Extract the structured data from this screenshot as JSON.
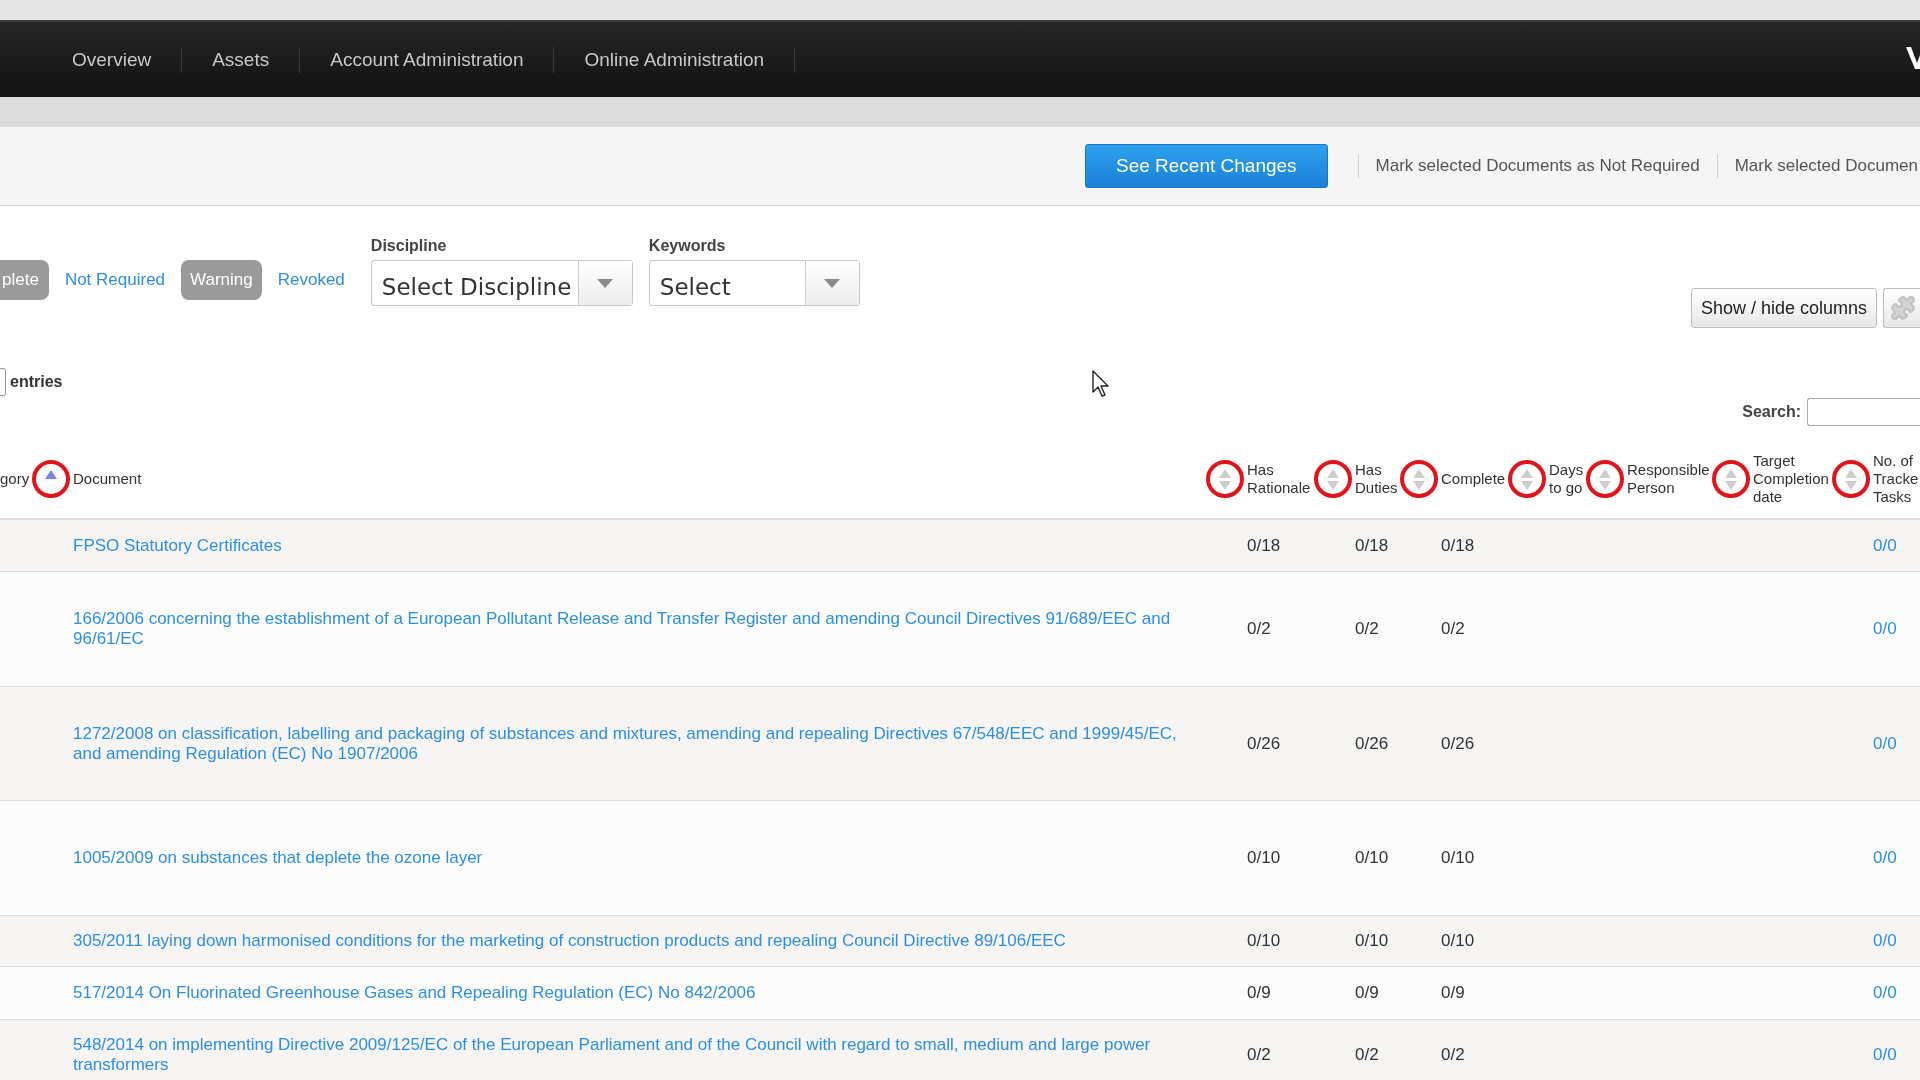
{
  "nav": {
    "items": [
      "Overview",
      "Assets",
      "Account Administration",
      "Online Administration"
    ]
  },
  "toolbar": {
    "button": "See Recent Changes",
    "links": [
      "Mark selected Documents as Not Required",
      "Mark selected Documen"
    ]
  },
  "filters": {
    "status": [
      {
        "label": "plete",
        "selected": true
      },
      {
        "label": "Not Required",
        "selected": false
      },
      {
        "label": "Warning",
        "selected": true
      },
      {
        "label": "Revoked",
        "selected": false
      }
    ],
    "dropdowns": [
      {
        "label": "Discipline",
        "placeholder": "Select Discipline"
      },
      {
        "label": "Keywords",
        "placeholder": "Select"
      }
    ]
  },
  "columns_button": "Show / hide columns",
  "length_menu": {
    "label": "entries"
  },
  "search": {
    "label": "Search:"
  },
  "table": {
    "columns": [
      {
        "label": "gory",
        "sorted": true,
        "circled": true
      },
      {
        "label": "Document",
        "sorted": false,
        "circled": true
      },
      {
        "label": "Has Rationale",
        "sorted": false,
        "circled": true
      },
      {
        "label": "Has Duties",
        "sorted": false,
        "circled": true
      },
      {
        "label": "Complete",
        "sorted": false,
        "circled": true
      },
      {
        "label": "Days to go",
        "sorted": false,
        "circled": true
      },
      {
        "label": "Responsible Person",
        "sorted": false,
        "circled": true
      },
      {
        "label": "Target Completion date",
        "sorted": false,
        "circled": true
      },
      {
        "label": "No. of Tracke Tasks"
      }
    ],
    "rows": [
      {
        "document": "FPSO Statutory Certificates",
        "has_rationale": "0/18",
        "has_duties": "0/18",
        "complete": "0/18",
        "tracked_tasks": "0/0"
      },
      {
        "document": "166/2006 concerning the establishment of a European Pollutant Release and Transfer Register and amending Council Directives 91/689/EEC and 96/61/EC",
        "has_rationale": "0/2",
        "has_duties": "0/2",
        "complete": "0/2",
        "tracked_tasks": "0/0"
      },
      {
        "document": "1272/2008 on classification, labelling and packaging of substances and mixtures, amending and repealing Directives 67/548/EEC and 1999/45/EC, and amending Regulation (EC) No 1907/2006",
        "has_rationale": "0/26",
        "has_duties": "0/26",
        "complete": "0/26",
        "tracked_tasks": "0/0"
      },
      {
        "document": "1005/2009 on substances that deplete the ozone layer",
        "has_rationale": "0/10",
        "has_duties": "0/10",
        "complete": "0/10",
        "tracked_tasks": "0/0"
      },
      {
        "document": "305/2011 laying down harmonised conditions for the marketing of construction products and repealing Council Directive 89/106/EEC",
        "has_rationale": "0/10",
        "has_duties": "0/10",
        "complete": "0/10",
        "tracked_tasks": "0/0"
      },
      {
        "document": "517/2014 On Fluorinated Greenhouse Gases and Repealing Regulation (EC) No 842/2006",
        "has_rationale": "0/9",
        "has_duties": "0/9",
        "complete": "0/9",
        "tracked_tasks": "0/0"
      },
      {
        "document": "548/2014 on implementing Directive 2009/125/EC of the European Parliament and of the Council with regard to small, medium and large power transformers",
        "has_rationale": "0/2",
        "has_duties": "0/2",
        "complete": "0/2",
        "tracked_tasks": "0/0"
      }
    ]
  }
}
